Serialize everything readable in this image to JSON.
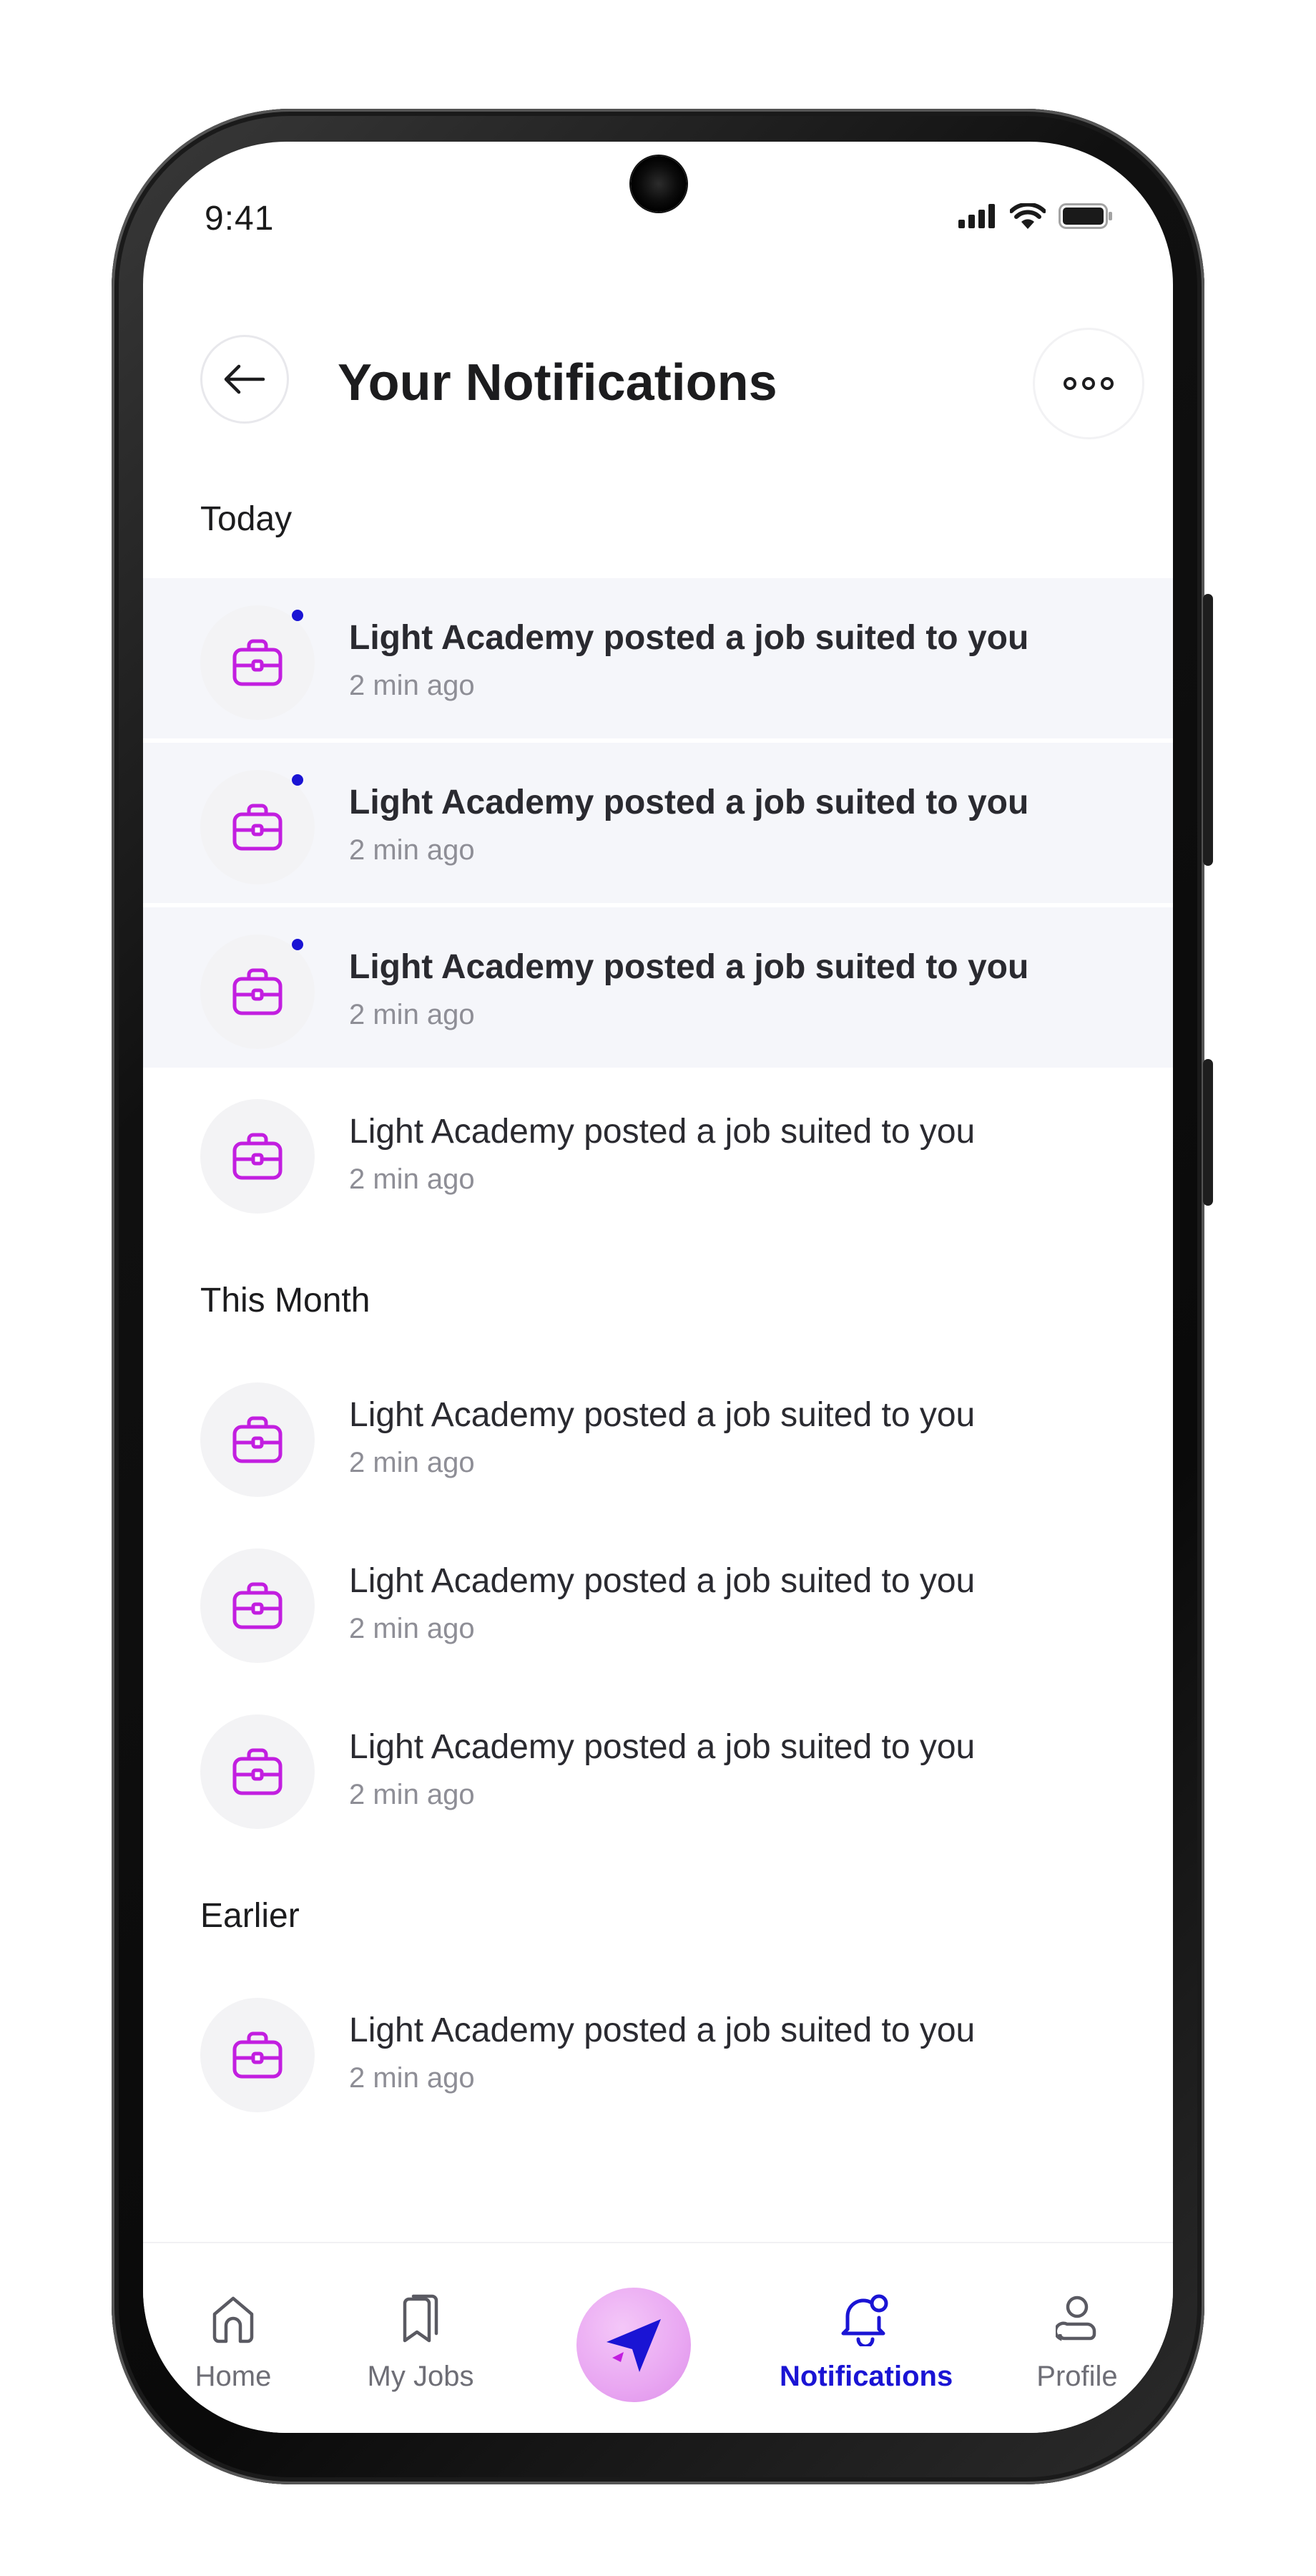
{
  "status_bar": {
    "time": "9:41"
  },
  "header": {
    "title": "Your Notifications"
  },
  "sections": {
    "today": "Today",
    "this_month": "This Month",
    "earlier": "Earlier"
  },
  "notifications": [
    {
      "message": "Light Academy posted a job suited to you",
      "time": "2 min ago",
      "unread": true,
      "icon": "briefcase-icon"
    },
    {
      "message": "Light Academy posted a job suited to you",
      "time": "2 min ago",
      "unread": true,
      "icon": "briefcase-icon"
    },
    {
      "message": "Light Academy posted a job suited to you",
      "time": "2 min ago",
      "unread": true,
      "icon": "briefcase-icon"
    },
    {
      "message": "Light Academy posted a job suited to you",
      "time": "2 min ago",
      "unread": false,
      "icon": "briefcase-icon"
    },
    {
      "message": "Light Academy posted a job suited to you",
      "time": "2 min ago",
      "unread": false,
      "icon": "briefcase-icon"
    },
    {
      "message": "Light Academy posted a job suited to you",
      "time": "2 min ago",
      "unread": false,
      "icon": "briefcase-icon"
    },
    {
      "message": "Light Academy posted a job suited to you",
      "time": "2 min ago",
      "unread": false,
      "icon": "briefcase-icon"
    },
    {
      "message": "Light Academy posted a job suited to you",
      "time": "2 min ago",
      "unread": false,
      "icon": "briefcase-icon"
    }
  ],
  "bottom_nav": {
    "home": "Home",
    "my_jobs": "My Jobs",
    "notifications": "Notifications",
    "profile": "Profile"
  },
  "colors": {
    "accent": "#1a14d4",
    "icon": "#c21ee0",
    "unread_bg": "#f5f6fa"
  }
}
